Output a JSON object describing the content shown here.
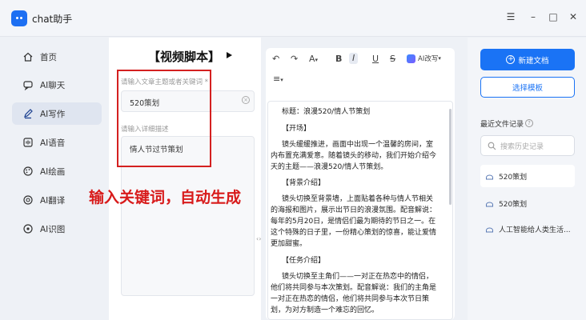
{
  "app": {
    "title": "chat助手"
  },
  "window_controls": {
    "menu": "☰",
    "minimize": "–",
    "maximize": "□",
    "close": "✕"
  },
  "sidebar": {
    "items": [
      {
        "label": "首页",
        "icon": "home-icon"
      },
      {
        "label": "AI聊天",
        "icon": "chat-icon"
      },
      {
        "label": "AI写作",
        "icon": "pen-icon",
        "active": true
      },
      {
        "label": "AI语音",
        "icon": "voice-icon"
      },
      {
        "label": "AI绘画",
        "icon": "paint-icon"
      },
      {
        "label": "AI翻译",
        "icon": "translate-icon"
      },
      {
        "label": "AI识图",
        "icon": "image-icon"
      }
    ]
  },
  "form": {
    "title": "【视频脚本】",
    "keyword_label": "请输入文章主题或者关键词 *",
    "keyword_value": "520策划",
    "detail_label": "请输入详细描述",
    "detail_value": "情人节过节策划"
  },
  "annotation": {
    "text": "输入关键词，自动生成"
  },
  "editor": {
    "toolbar": {
      "undo": "↶",
      "redo": "↷",
      "font_color": "A",
      "bold": "B",
      "italic": "I",
      "underline": "U",
      "strike": "S",
      "ai_label": "AI改写",
      "list": "≡"
    },
    "lines": [
      "标题：浪漫520/情人节策划",
      "【开场】",
      "镜头缓缓推进，画面中出现一个温馨的房间，室",
      "内布置充满爱意。随着镜头的移动，我们开始介绍今",
      "天的主题——浪漫520/情人节策划。",
      "【背景介绍】",
      "镜头切换至背景墙，上面贴着各种与情人节相关",
      "的海报和图片，展示出节日的浪漫氛围。配音解说：",
      "每年的5月20日，是情侣们最为期待的节日之一。在",
      "这个特殊的日子里，一份精心策划的惊喜，能让爱情",
      "更加甜蜜。",
      "【任务介绍】",
      "镜头切换至主角们——一对正在热恋中的情侣，",
      "他们将共同参与本次策划。配音解说：我们的主角是",
      "一对正在热恋的情侣，他们将共同参与本次节日策",
      "划，为对方制造一个难忘的回忆。"
    ]
  },
  "right_panel": {
    "new_doc_label": "新建文档",
    "template_label": "选择模板",
    "recent_title": "最近文件记录",
    "search_placeholder": "搜索历史记录",
    "recent_items": [
      "520策划",
      "520策划",
      "人工智能给人类生活..."
    ]
  },
  "colors": {
    "accent": "#1a73f5",
    "annotation": "#d81b1b"
  }
}
